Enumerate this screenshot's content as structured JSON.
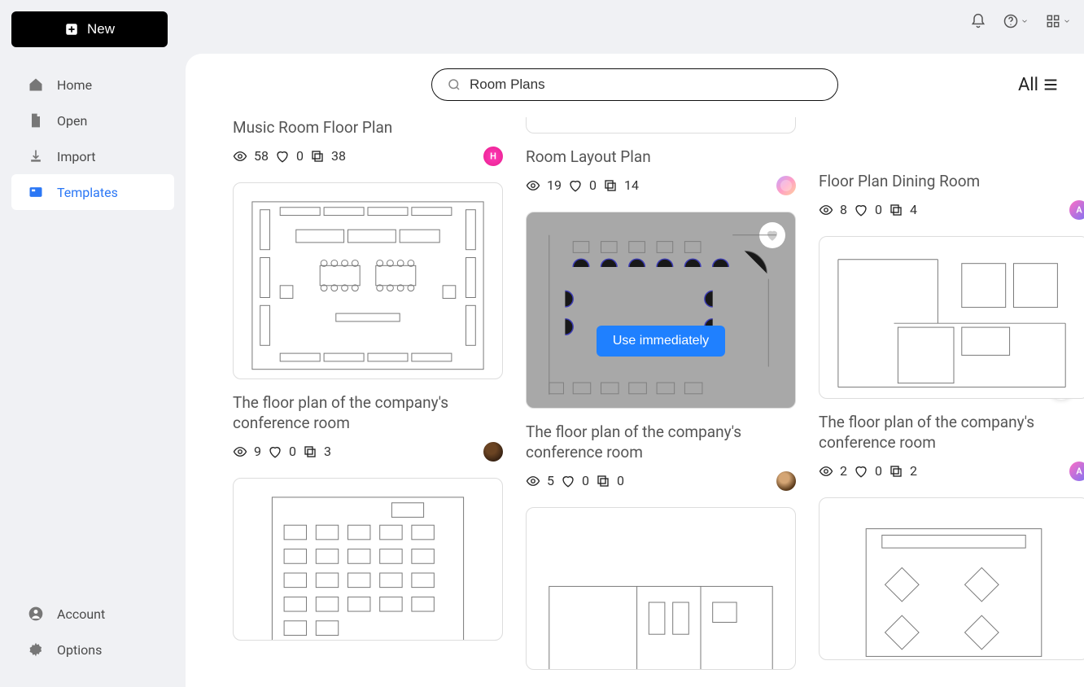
{
  "new_button": "New",
  "nav": {
    "home": "Home",
    "open": "Open",
    "import": "Import",
    "templates": "Templates",
    "account": "Account",
    "options": "Options"
  },
  "search": {
    "value": "Room Plans"
  },
  "filter": {
    "label": "All"
  },
  "hover_button": "Use immediately",
  "cards": {
    "c1": {
      "title": "Music Room Floor Plan",
      "views": "58",
      "likes": "0",
      "copies": "38"
    },
    "c2": {
      "title": "The floor plan of the company's conference room",
      "views": "9",
      "likes": "0",
      "copies": "3"
    },
    "c3": {
      "title": "Room Layout Plan",
      "views": "19",
      "likes": "0",
      "copies": "14"
    },
    "c4": {
      "title": "The floor plan of the company's conference room",
      "views": "5",
      "likes": "0",
      "copies": "0"
    },
    "c5": {
      "title": "Floor Plan Dining Room",
      "views": "8",
      "likes": "0",
      "copies": "4"
    },
    "c6": {
      "title": "The floor plan of the company's conference room",
      "views": "2",
      "likes": "0",
      "copies": "2"
    }
  }
}
